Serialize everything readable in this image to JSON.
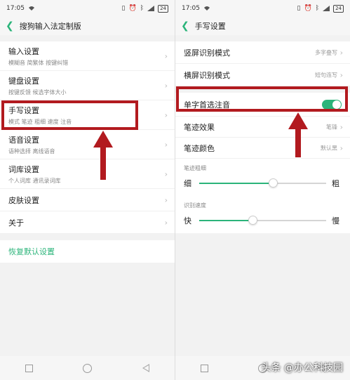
{
  "colors": {
    "accent": "#2bb47a",
    "highlight": "#b21a1f"
  },
  "left": {
    "status": {
      "time": "17:05",
      "battery": "24"
    },
    "title": "搜狗输入法定制版",
    "items": [
      {
        "label": "输入设置",
        "sub": "模糊音 简繁体 按键纠错"
      },
      {
        "label": "键盘设置",
        "sub": "按键反馈 候选字体大小"
      },
      {
        "label": "手写设置",
        "sub": "模式 笔迹 粗细 速度 注音"
      },
      {
        "label": "语音设置",
        "sub": "语种选择 离线语音"
      },
      {
        "label": "词库设置",
        "sub": "个人词库 通讯录词库"
      },
      {
        "label": "皮肤设置",
        "sub": ""
      },
      {
        "label": "关于",
        "sub": ""
      }
    ],
    "restore": "恢复默认设置"
  },
  "right": {
    "status": {
      "time": "17:05",
      "battery": "24"
    },
    "title": "手写设置",
    "rows": [
      {
        "label": "竖屏识别模式",
        "value": "多字叠写"
      },
      {
        "label": "横屏识别模式",
        "value": "短句连写"
      },
      {
        "label": "单字首选注音",
        "value": ""
      },
      {
        "label": "笔迹效果",
        "value": "笔锋"
      },
      {
        "label": "笔迹颜色",
        "value": "默认黑"
      }
    ],
    "stroke_width": {
      "label": "笔迹粗细",
      "min_label": "细",
      "max_label": "粗",
      "value": 0.58
    },
    "speed": {
      "label": "识别速度",
      "min_label": "快",
      "max_label": "慢",
      "value": 0.42
    },
    "toggle_on": true
  },
  "watermark": "头条 @办公科技园"
}
